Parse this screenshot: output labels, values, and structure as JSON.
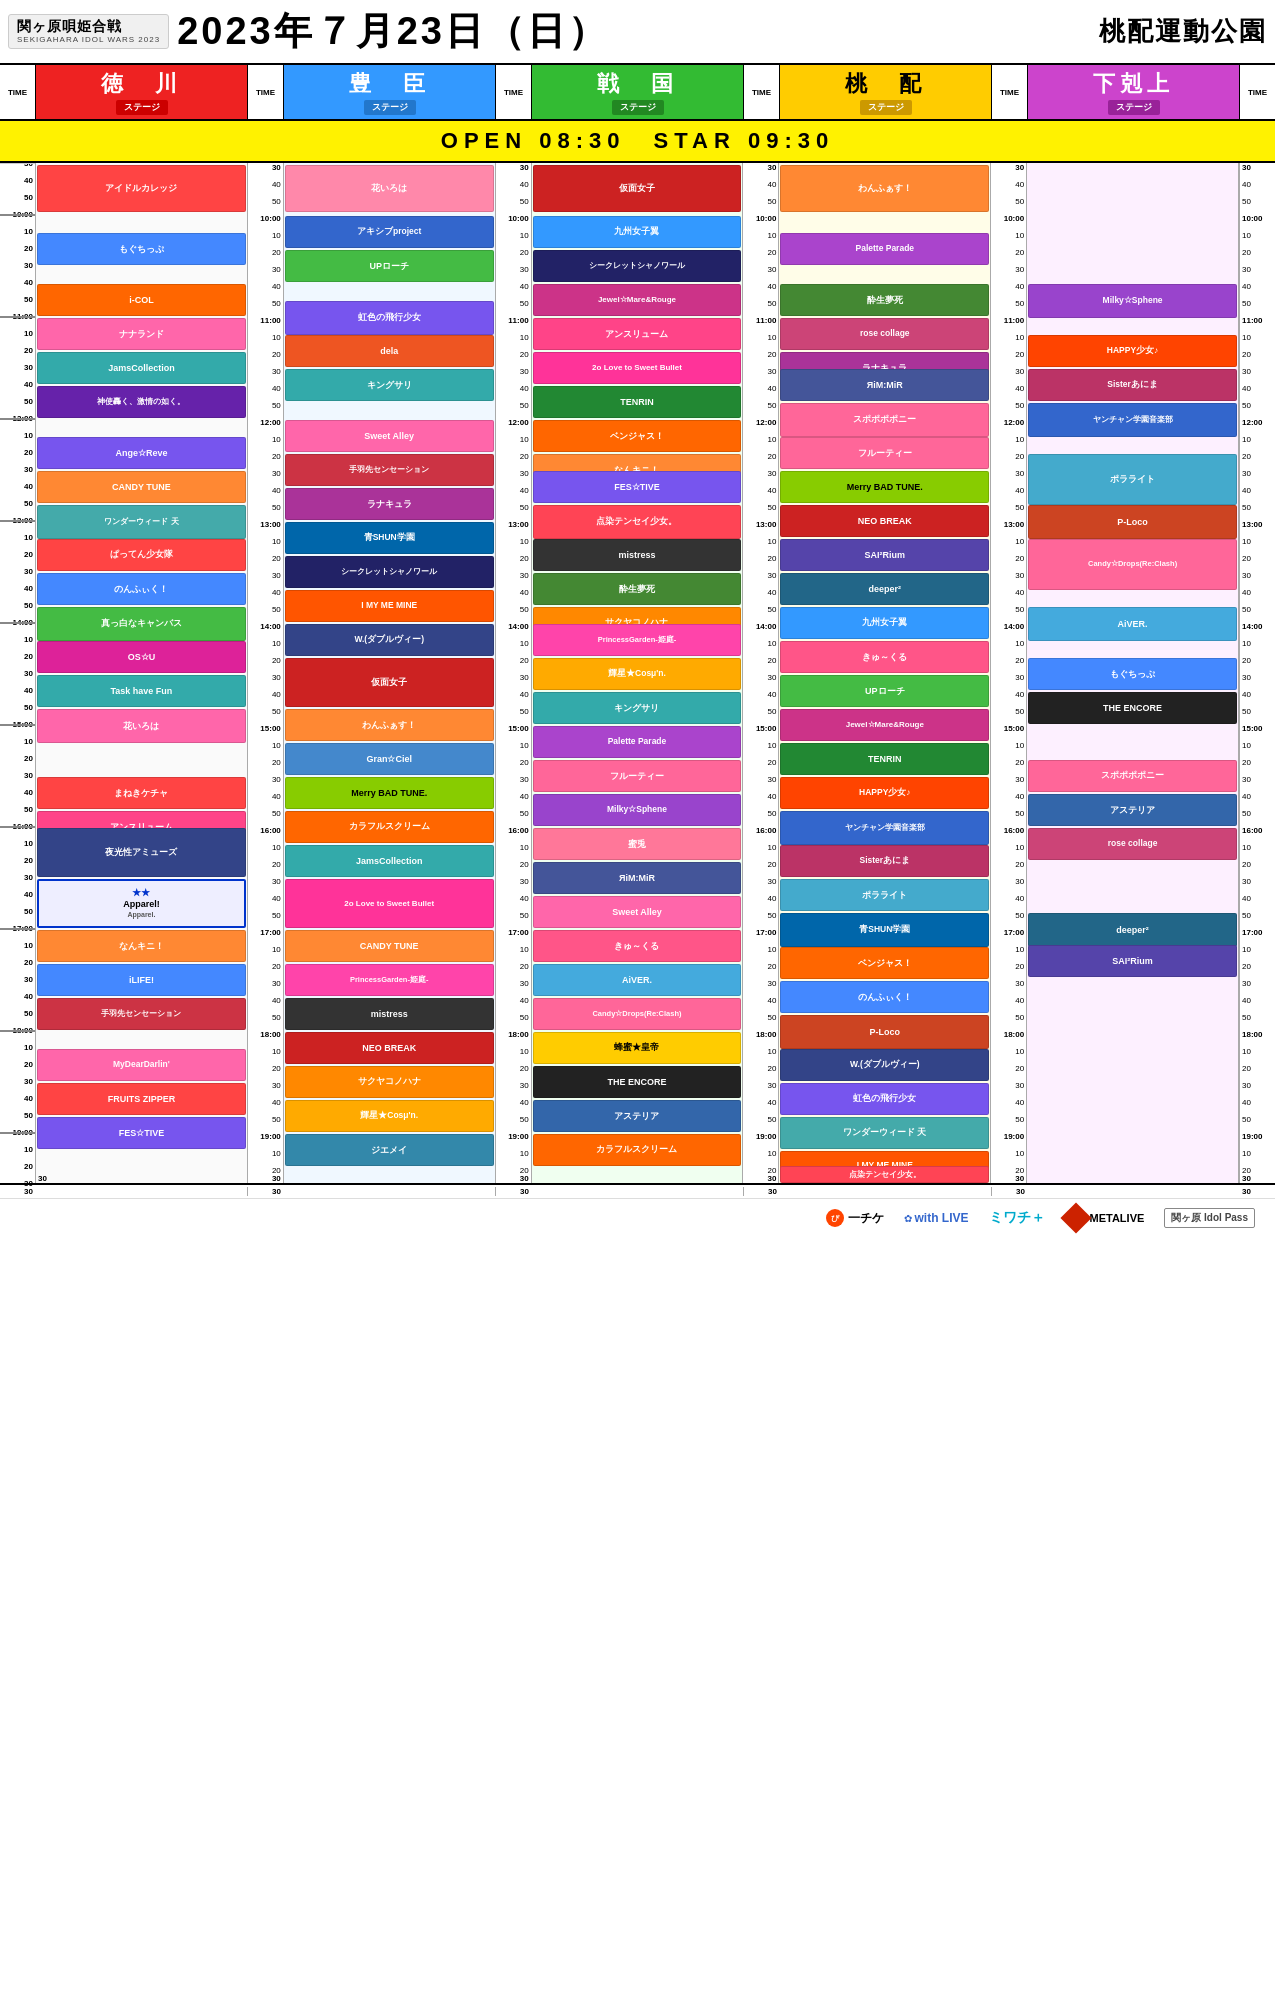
{
  "header": {
    "logo_line1": "関ヶ原唄姫合戦",
    "logo_line2": "SEKIGAHARA IDOL WARS 2023",
    "date": "2023年７月23日（日）",
    "venue": "桃配運動公園",
    "open_text": "OPEN 08:30　STAR 09:30"
  },
  "stages": [
    {
      "id": "tokugawa",
      "kanji": "徳　川",
      "color": "#ee2222",
      "label": "ステージ",
      "label_bg": "#cc0000"
    },
    {
      "id": "toyotomi",
      "kanji": "豊　臣",
      "color": "#3399ff",
      "label": "ステージ",
      "label_bg": "#2277cc"
    },
    {
      "id": "sengoku",
      "kanji": "戦　国",
      "color": "#33bb33",
      "label": "ステージ",
      "label_bg": "#228822"
    },
    {
      "id": "momokubari",
      "kanji": "桃　配",
      "color": "#ffcc00",
      "label": "ステージ",
      "label_bg": "#cc9900"
    },
    {
      "id": "gekokujo",
      "kanji": "下剋上",
      "color": "#cc44cc",
      "label": "ステージ",
      "label_bg": "#992299"
    }
  ],
  "time_col_label": "TIME",
  "footer": {
    "logos": [
      "ぴ一チケ",
      "with LIVE",
      "ミワチ＋",
      "METALIVE",
      "関ヶ原 Idol Pass"
    ]
  }
}
